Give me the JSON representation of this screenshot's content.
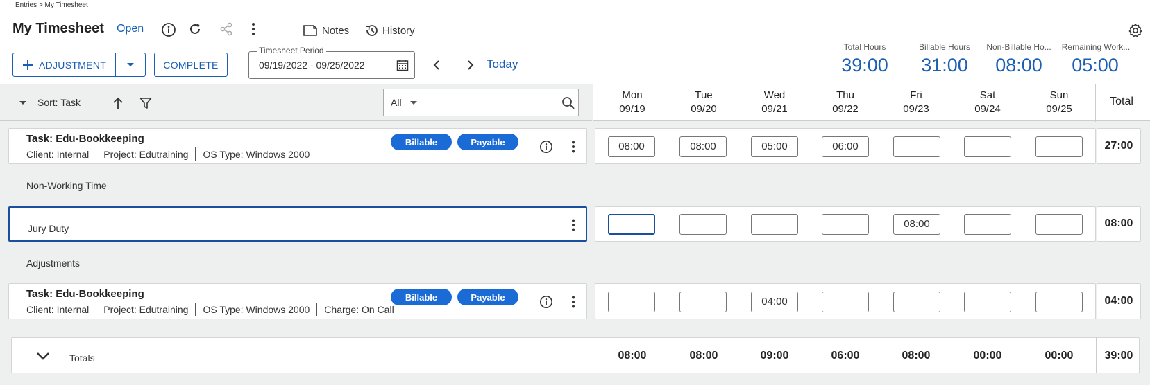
{
  "breadcrumb": "Entries > My Timesheet",
  "page_title": "My Timesheet",
  "status_link": "Open",
  "toolbar": {
    "notes_label": "Notes",
    "history_label": "History"
  },
  "actions": {
    "adjustment_label": "ADJUSTMENT",
    "complete_label": "COMPLETE"
  },
  "period": {
    "legend": "Timesheet Period",
    "value": "09/19/2022 - 09/25/2022"
  },
  "today_label": "Today",
  "summary": [
    {
      "label": "Total Hours",
      "value": "39:00"
    },
    {
      "label": "Billable Hours",
      "value": "31:00"
    },
    {
      "label": "Non-Billable Ho...",
      "value": "08:00"
    },
    {
      "label": "Remaining Work...",
      "value": "05:00"
    }
  ],
  "grid_toolbar": {
    "sort_label": "Sort: Task",
    "filter_value": "All"
  },
  "days": [
    {
      "name": "Mon",
      "date": "09/19"
    },
    {
      "name": "Tue",
      "date": "09/20"
    },
    {
      "name": "Wed",
      "date": "09/21"
    },
    {
      "name": "Thu",
      "date": "09/22"
    },
    {
      "name": "Fri",
      "date": "09/23"
    },
    {
      "name": "Sat",
      "date": "09/24"
    },
    {
      "name": "Sun",
      "date": "09/25"
    }
  ],
  "total_header": "Total",
  "rows": {
    "task1": {
      "title": "Task: Edu-Bookkeeping",
      "client": "Client: Internal",
      "project": "Project: Edutraining",
      "os": "OS Type: Windows 2000",
      "badge1": "Billable",
      "badge2": "Payable",
      "hours": [
        "08:00",
        "08:00",
        "05:00",
        "06:00",
        "",
        "",
        ""
      ],
      "total": "27:00"
    },
    "section_nonworking": "Non-Working Time",
    "jury": {
      "title": "Jury Duty",
      "hours": [
        "",
        "",
        "",
        "",
        "08:00",
        "",
        ""
      ],
      "total": "08:00"
    },
    "section_adjustments": "Adjustments",
    "task2": {
      "title": "Task: Edu-Bookkeeping",
      "client": "Client: Internal",
      "project": "Project: Edutraining",
      "os": "OS Type: Windows 2000",
      "charge": "Charge: On Call",
      "badge1": "Billable",
      "badge2": "Payable",
      "hours": [
        "",
        "",
        "04:00",
        "",
        "",
        "",
        ""
      ],
      "total": "04:00"
    }
  },
  "totals": {
    "label": "Totals",
    "values": [
      "08:00",
      "08:00",
      "09:00",
      "06:00",
      "08:00",
      "00:00",
      "00:00"
    ],
    "grand": "39:00"
  },
  "colors": {
    "accent": "#1a5fb4",
    "badge": "#1a6bd6",
    "grid_bg": "#eef0f0"
  }
}
